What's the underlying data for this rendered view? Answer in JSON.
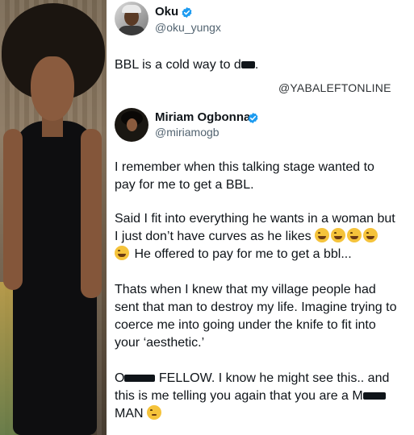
{
  "tweet1": {
    "name": "Oku",
    "handle": "@oku_yungx",
    "text": "BBL is a cold way to d",
    "text_end": "."
  },
  "watermark": "@YABALEFTONLINE",
  "tweet2": {
    "name": "Miriam Ogbonna",
    "handle": "@miriamogb",
    "lines": [
      "I remember when this talking stage wanted to",
      "pay for me to get a BBL.",
      "Said I fit into everything he wants in a woman but",
      "I just don’t have curves as he likes",
      "He offered to pay for me to get a bbl...",
      "Thats when I knew that my village people had",
      "sent that man to destroy my life. Imagine trying to",
      "coerce me into going under the knife to fit into",
      "your ‘aesthetic.’",
      "FELLOW. I know he might see this.. and",
      "this is me telling you again that you are a",
      "MAN"
    ],
    "redacted_prefix_1": "O",
    "redacted_prefix_2": "M"
  },
  "icons": {
    "verified": "verified-badge-icon",
    "laugh": "face-with-tears-of-joy-icon",
    "pensive": "pensive-face-icon"
  },
  "colors": {
    "verified": "#1d9bf0",
    "text": "#0f1419",
    "muted": "#536471"
  }
}
